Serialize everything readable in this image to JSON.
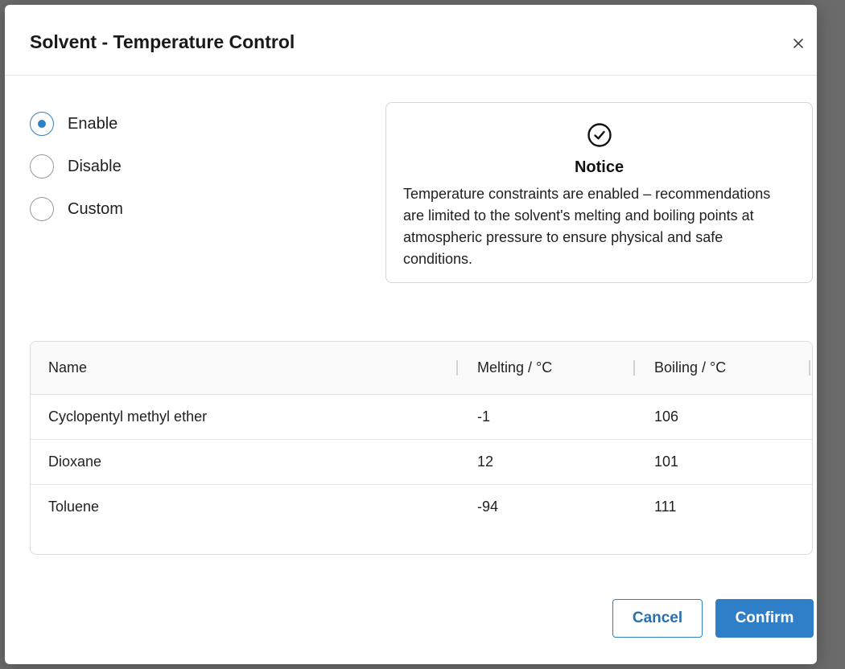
{
  "dialog": {
    "title": "Solvent - Temperature Control"
  },
  "options": [
    {
      "label": "Enable",
      "checked": true
    },
    {
      "label": "Disable",
      "checked": false
    },
    {
      "label": "Custom",
      "checked": false
    }
  ],
  "notice": {
    "title": "Notice",
    "body": "Temperature constraints are enabled – recommendations are limited to the solvent's melting and boiling points at atmospheric pressure to ensure physical and safe conditions."
  },
  "table": {
    "headers": {
      "name": "Name",
      "melting": "Melting / °C",
      "boiling": "Boiling / °C"
    },
    "rows": [
      {
        "name": "Cyclopentyl methyl ether",
        "melting": "-1",
        "boiling": "106"
      },
      {
        "name": "Dioxane",
        "melting": "12",
        "boiling": "101"
      },
      {
        "name": "Toluene",
        "melting": "-94",
        "boiling": "111"
      }
    ]
  },
  "buttons": {
    "cancel": "Cancel",
    "confirm": "Confirm"
  },
  "colors": {
    "accent": "#2f7fc8"
  }
}
